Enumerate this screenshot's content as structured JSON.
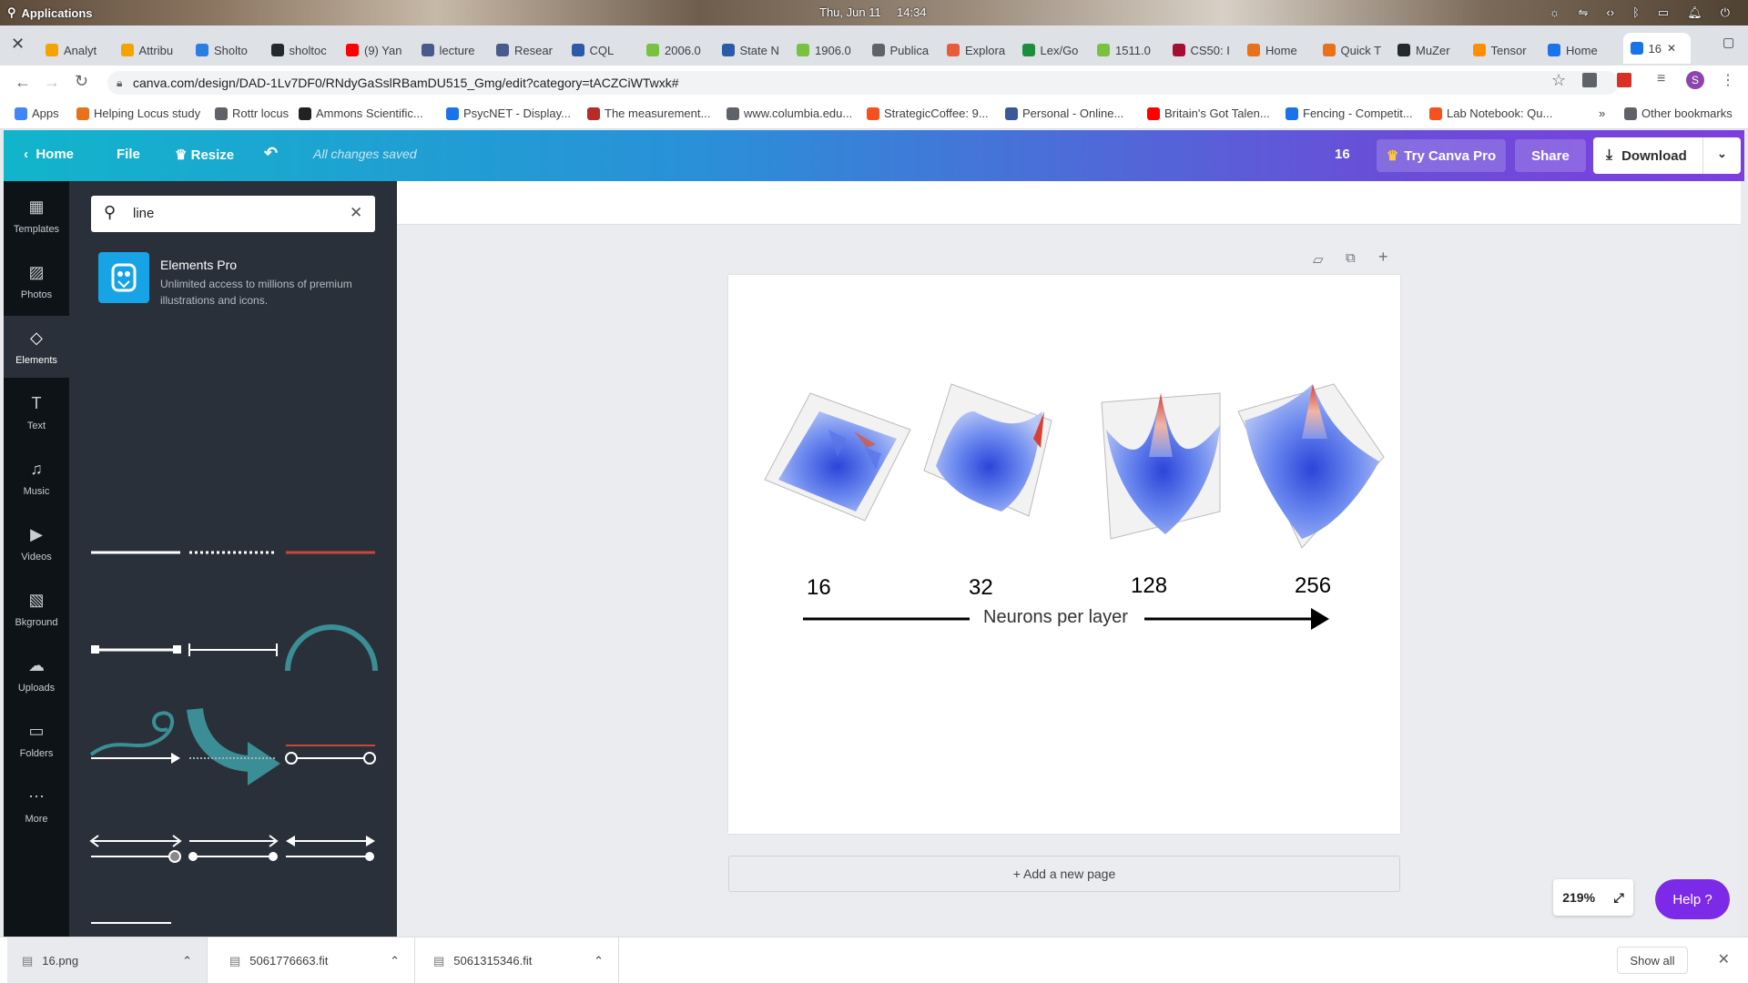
{
  "system": {
    "apps": "Applications",
    "date": "Thu, Jun 11",
    "time": "14:34"
  },
  "tabs": [
    {
      "label": "Analyt",
      "color": "#f4a300"
    },
    {
      "label": "Attribu",
      "color": "#f4a300"
    },
    {
      "label": "Sholto",
      "color": "#2a7de1"
    },
    {
      "label": "sholtoc",
      "color": "#24292e"
    },
    {
      "label": "(9) Yan",
      "color": "#ff0000"
    },
    {
      "label": "lecture",
      "color": "#4a5a8a"
    },
    {
      "label": "Resear",
      "color": "#4a5a8a"
    },
    {
      "label": "CQL",
      "color": "#2b5aa8"
    },
    {
      "label": "2006.0",
      "color": "#7ac142"
    },
    {
      "label": "State N",
      "color": "#2b5aa8"
    },
    {
      "label": "1906.0",
      "color": "#7ac142"
    },
    {
      "label": "Publica",
      "color": "#5f6368"
    },
    {
      "label": "Explora",
      "color": "#e85c3a"
    },
    {
      "label": "Lex/Go",
      "color": "#1e8e3e"
    },
    {
      "label": "1511.0",
      "color": "#7ac142"
    },
    {
      "label": "CS50: I",
      "color": "#a41034"
    },
    {
      "label": "Home",
      "color": "#e8711a"
    },
    {
      "label": "Quick T",
      "color": "#e8711a"
    },
    {
      "label": "MuZer",
      "color": "#24292e"
    },
    {
      "label": "Tensor",
      "color": "#ff8f00"
    },
    {
      "label": "Home",
      "color": "#1a73e8"
    },
    {
      "label": "16",
      "color": "#1a73e8",
      "active": true
    }
  ],
  "address": {
    "url": "canva.com/design/DAD-1Lv7DF0/RNdyGaSslRBamDU515_Gmg/edit?category=tACZCiWTwxk#"
  },
  "bookmarks": [
    {
      "label": "Apps",
      "color": "#4285f4"
    },
    {
      "label": "Helping Locus study",
      "color": "#e8711a"
    },
    {
      "label": "Rottr locus",
      "color": "#5f6368"
    },
    {
      "label": "Ammons Scientific...",
      "color": "#222"
    },
    {
      "label": "PsycNET - Display...",
      "color": "#1a73e8"
    },
    {
      "label": "The measurement...",
      "color": "#b92b27"
    },
    {
      "label": "www.columbia.edu...",
      "color": "#5f6368"
    },
    {
      "label": "StrategicCoffee: 9...",
      "color": "#f4511e"
    },
    {
      "label": "Personal - Online...",
      "color": "#3b5998"
    },
    {
      "label": "Britain's Got Talen...",
      "color": "#ff0000"
    },
    {
      "label": "Fencing - Competit...",
      "color": "#1a73e8"
    },
    {
      "label": "Lab Notebook: Qu...",
      "color": "#f4511e"
    }
  ],
  "bookmarks_more": "»",
  "other_bookmarks": "Other bookmarks",
  "canva": {
    "home": "Home",
    "file": "File",
    "resize": "Resize",
    "saved": "All changes saved",
    "page_count": "16",
    "try_pro": "Try Canva Pro",
    "share": "Share",
    "download": "Download"
  },
  "sidebar": [
    {
      "label": "Templates",
      "icon": "templates-icon"
    },
    {
      "label": "Photos",
      "icon": "photos-icon"
    },
    {
      "label": "Elements",
      "icon": "elements-icon",
      "selected": true
    },
    {
      "label": "Text",
      "icon": "text-icon"
    },
    {
      "label": "Music",
      "icon": "music-icon"
    },
    {
      "label": "Videos",
      "icon": "videos-icon"
    },
    {
      "label": "Bkground",
      "icon": "background-icon"
    },
    {
      "label": "Uploads",
      "icon": "uploads-icon"
    },
    {
      "label": "Folders",
      "icon": "folders-icon"
    },
    {
      "label": "More",
      "icon": "more-icon"
    }
  ],
  "panel": {
    "search_value": "line",
    "pro_title": "Elements Pro",
    "pro_desc": "Unlimited access to millions of premium illustrations and icons."
  },
  "design": {
    "numbers": [
      "16",
      "32",
      "128",
      "256"
    ],
    "caption": "Neurons per layer",
    "accent_blue": "#3b5bdb",
    "accent_red": "#e0522c"
  },
  "stage": {
    "add_page": "+ Add a new page",
    "zoom": "219%",
    "help": "Help ?"
  },
  "downloads": [
    {
      "name": "16.png"
    },
    {
      "name": "5061776663.fit"
    },
    {
      "name": "5061315346.fit"
    }
  ],
  "show_all": "Show all"
}
